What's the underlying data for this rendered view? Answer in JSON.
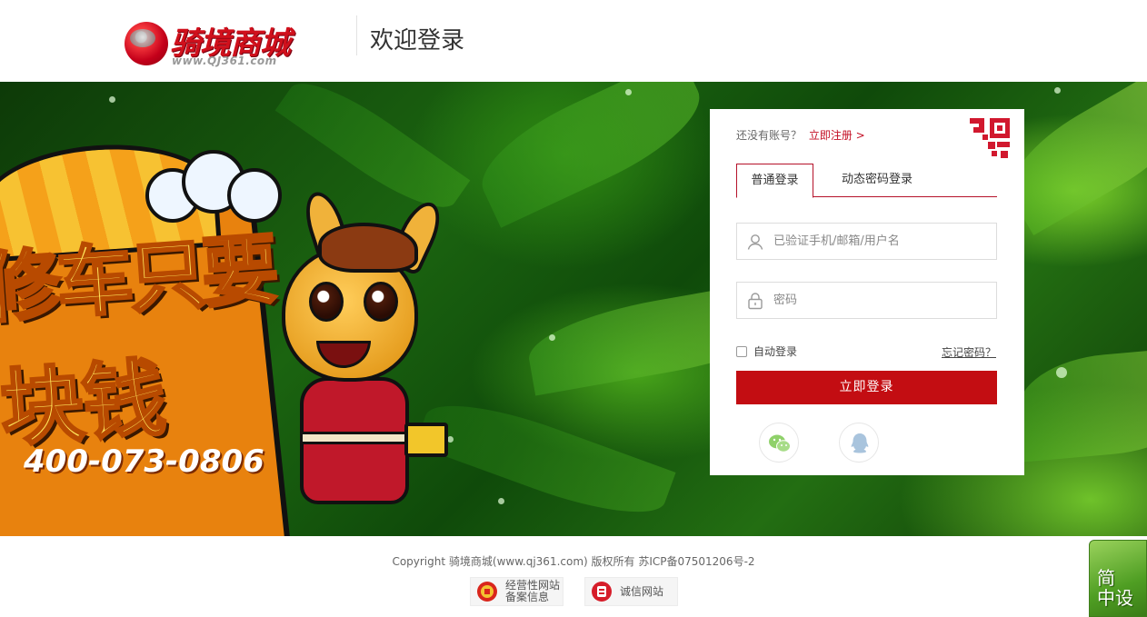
{
  "header": {
    "logo_name": "骑境商城",
    "logo_url": "www.QJ361.com",
    "welcome": "欢迎登录"
  },
  "banner": {
    "promo_line1": "修车只要",
    "promo_line2": "块钱",
    "phone": "400-073-0806"
  },
  "login": {
    "no_account_text": "还没有账号？",
    "register_link": "立即注册 >",
    "tabs": [
      {
        "label": "普通登录",
        "active": true
      },
      {
        "label": "动态密码登录",
        "active": false
      }
    ],
    "username_placeholder": "已验证手机/邮箱/用户名",
    "password_placeholder": "密码",
    "remember_label": "自动登录",
    "forgot_label": "忘记密码？",
    "submit_label": "立即登录",
    "social": [
      {
        "icon": "wechat-icon"
      },
      {
        "icon": "qq-icon"
      }
    ],
    "accent_color": "#c30d12"
  },
  "footer": {
    "copyright": "Copyright 骑境商城(www.qj361.com) 版权所有 苏ICP备07501206号-2",
    "badge1_line1": "经营性网站",
    "badge1_line2": "备案信息",
    "badge2": "诚信网站"
  },
  "float_widget": {
    "line1": "简",
    "line2": "中设"
  }
}
